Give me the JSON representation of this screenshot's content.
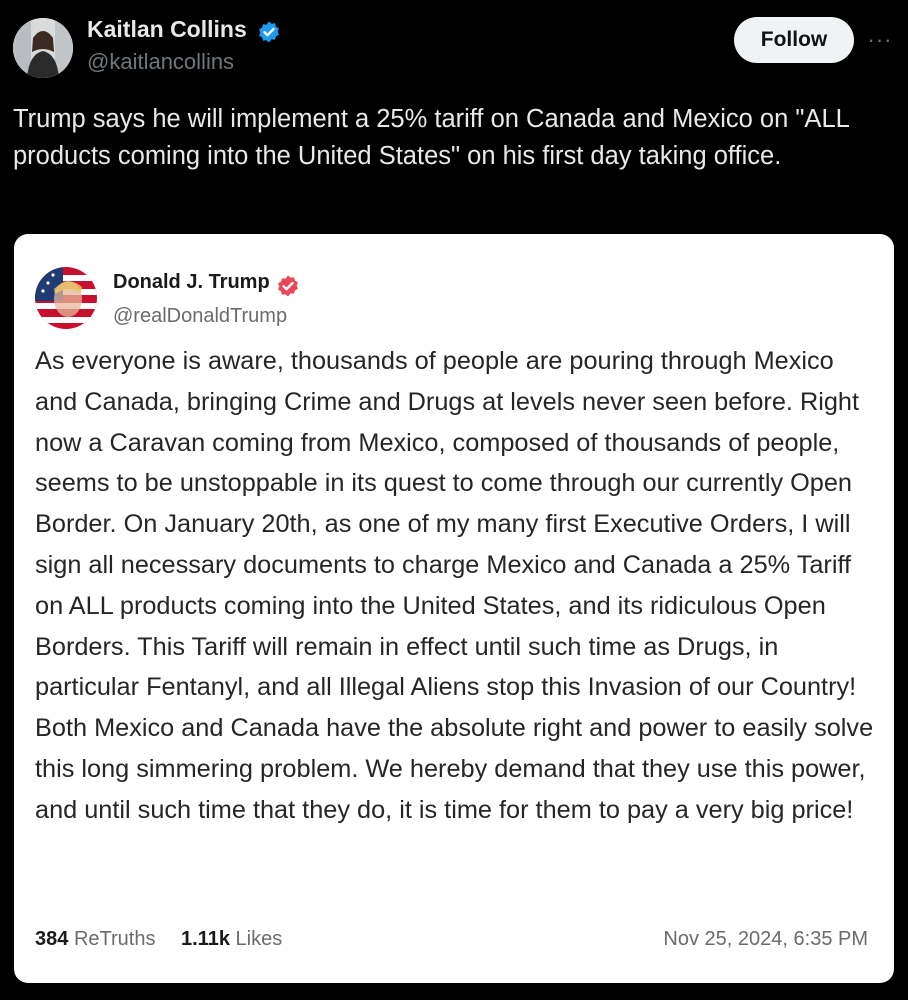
{
  "tweet": {
    "author_name": "Kaitlan Collins",
    "author_handle": "@kaitlancollins",
    "follow_label": "Follow",
    "more_label": "···",
    "text": "Trump says he will implement a 25% tariff on Canada and Mexico on \"ALL products coming into the United States\" on his first day taking office.",
    "verified_color": "#1d9bf0"
  },
  "embedded_post": {
    "author_name": "Donald J. Trump",
    "author_handle": "@realDonaldTrump",
    "verified_color": "#e8485a",
    "body": "As everyone is aware, thousands of people are pouring through Mexico and Canada, bringing Crime and Drugs at levels never seen before. Right now a Caravan coming from Mexico, composed of thousands of people, seems to be unstoppable in its quest to come through our currently Open Border. On January 20th, as one of my many first Executive Orders, I will sign all necessary documents to charge Mexico and Canada a 25% Tariff on ALL products coming into the United States, and its ridiculous Open Borders. This Tariff will remain in effect until such time as Drugs, in particular Fentanyl, and all Illegal Aliens stop this Invasion of our Country! Both Mexico and Canada have the absolute right and power to easily solve this long simmering problem. We hereby demand that they use this power, and until such time that they do, it is time for them to pay a very big price!",
    "retruths_count": "384",
    "retruths_label": "ReTruths",
    "likes_count": "1.11k",
    "likes_label": "Likes",
    "timestamp": "Nov 25, 2024, 6:35 PM"
  }
}
